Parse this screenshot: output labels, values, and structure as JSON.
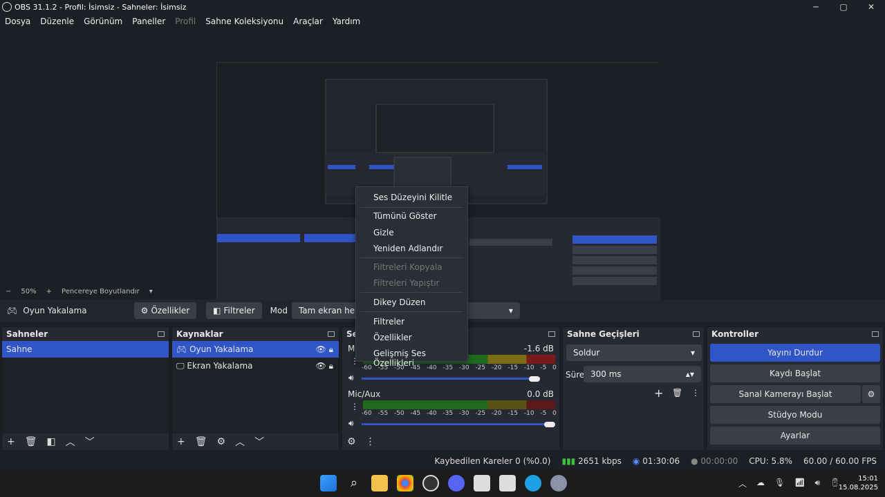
{
  "window": {
    "title": "OBS 31.1.2 - Profil: İsimsiz - Sahneler: İsimsiz",
    "min": "─",
    "max": "▢",
    "close": "✕"
  },
  "menu": [
    "Dosya",
    "Düzenle",
    "Görünüm",
    "Paneller",
    "Profil",
    "Sahne Koleksiyonu",
    "Araçlar",
    "Yardım"
  ],
  "zoom": {
    "minus": "−",
    "level": "50%",
    "plus": "+",
    "fit": "Pencereye Boyutlandır"
  },
  "source_toolbar": {
    "source": "Oyun Yakalama",
    "properties": "Özellikler",
    "filters": "Filtreler",
    "mode_label": "Mod",
    "mode_value": "Tam ekran herhangi bir"
  },
  "docks": {
    "scenes": {
      "title": "Sahneler",
      "items": [
        "Sahne"
      ]
    },
    "sources": {
      "title": "Kaynaklar",
      "items": [
        "Oyun Yakalama",
        "Ekran Yakalama"
      ]
    },
    "mixer": {
      "title": "Se",
      "tracks": [
        {
          "name": "M",
          "db": "-1.6 dB"
        },
        {
          "name": "Mic/Aux",
          "db": "0.0 dB"
        }
      ],
      "ticks": [
        "-60",
        "-55",
        "-50",
        "-45",
        "-40",
        "-35",
        "-30",
        "-25",
        "-20",
        "-15",
        "-10",
        "-5",
        "0"
      ]
    },
    "transitions": {
      "title": "Sahne Geçişleri",
      "type": "Soldur",
      "duration_label": "Süre",
      "duration": "300 ms"
    },
    "controls": {
      "title": "Kontroller",
      "stream": "Yayını Durdur",
      "record": "Kaydı Başlat",
      "vcam": "Sanal Kamerayı Başlat",
      "studio": "Stüdyo Modu",
      "settings": "Ayarlar"
    }
  },
  "context_menu": [
    "Ses Düzeyini Kilitle",
    "Tümünü Göster",
    "Gizle",
    "Yeniden Adlandır",
    "Filtreleri Kopyala",
    "Filtreleri Yapıştır",
    "Dikey Düzen",
    "Filtreler",
    "Özellikler",
    "Gelişmiş Ses Özellikleri"
  ],
  "status": {
    "dropped": "Kaybedilen Kareler 0 (%0.0)",
    "bitrate": "2651 kbps",
    "stream_time": "01:30:06",
    "rec_time": "00:00:00",
    "cpu": "CPU: 5.8%",
    "fps": "60.00 / 60.00 FPS"
  },
  "clock": {
    "time": "15:01",
    "date": "15.08.2025"
  },
  "colors": {
    "accent": "#2f55c7",
    "bg": "#1d1f26",
    "panel": "#262932"
  }
}
